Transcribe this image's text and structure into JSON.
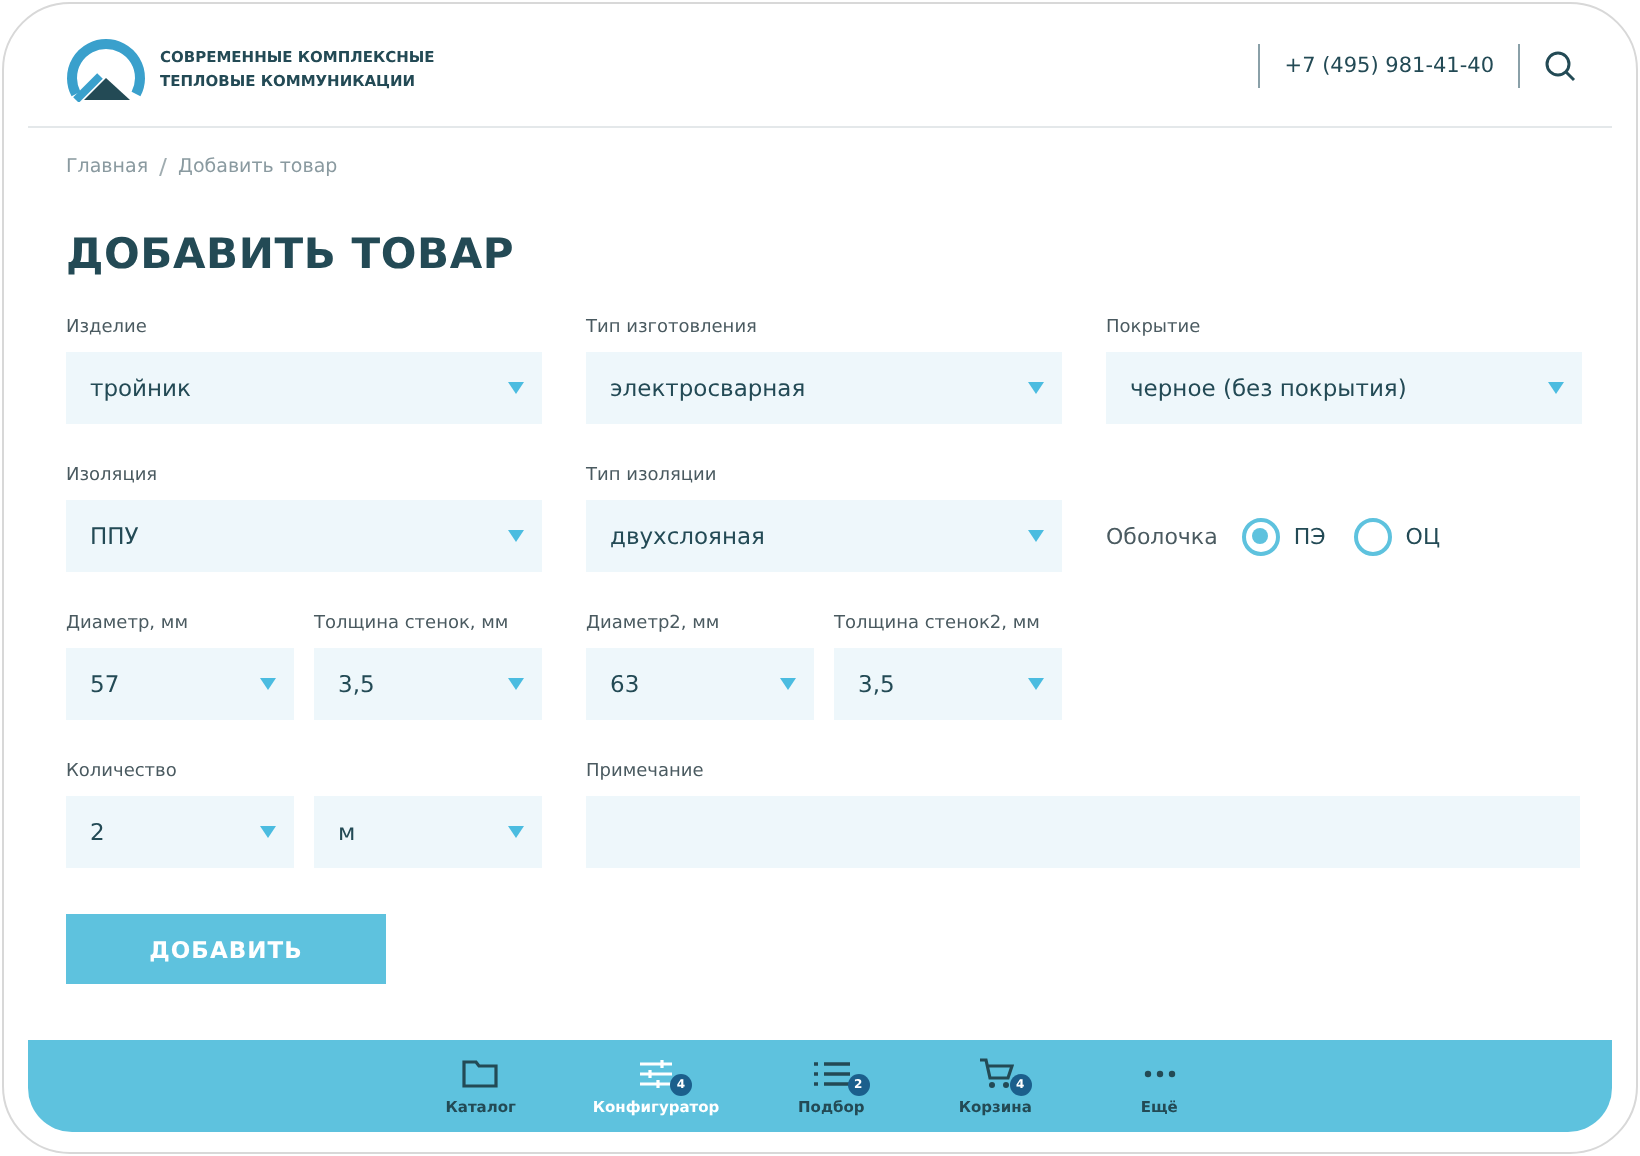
{
  "header": {
    "logo_text": [
      "СОВРЕМЕННЫЕ КОМПЛЕКСНЫЕ",
      "ТЕПЛОВЫЕ КОММУНИКАЦИИ"
    ],
    "phone": "+7 (495) 981-41-40"
  },
  "breadcrumbs": [
    "Главная",
    "Добавить товар"
  ],
  "title": "ДОБАВИТЬ ТОВАР",
  "form_rows": [
    [
      {
        "kind": "select",
        "label": "Изделие",
        "value": "тройник"
      },
      {
        "kind": "select",
        "label": "Тип изготовления",
        "value": "электросварная"
      },
      {
        "kind": "select",
        "label": "Покрытие",
        "value": "черное (без покрытия)"
      }
    ],
    [
      {
        "kind": "select",
        "label": "Изоляция",
        "value": "ППУ"
      },
      {
        "kind": "select",
        "label": "Тип изоляции",
        "value": "двухслояная"
      },
      {
        "kind": "radio",
        "label": "Оболочка",
        "options": [
          {
            "label": "ПЭ",
            "selected": true
          },
          {
            "label": "ОЦ",
            "selected": false
          }
        ]
      }
    ],
    [
      {
        "kind": "pair",
        "fields": [
          {
            "label": "Диаметр, мм",
            "value": "57"
          },
          {
            "label": "Толщина стенок, мм",
            "value": "3,5"
          }
        ]
      },
      {
        "kind": "pair",
        "fields": [
          {
            "label": "Диаметр2, мм",
            "value": "63"
          },
          {
            "label": "Толщина стенок2, мм",
            "value": "3,5"
          }
        ]
      }
    ],
    [
      {
        "kind": "pair",
        "fields": [
          {
            "label": "Количество",
            "value": "2"
          },
          {
            "value": "м"
          }
        ]
      },
      {
        "kind": "text",
        "label": "Примечание"
      }
    ]
  ],
  "submit": "ДОБАВИТЬ",
  "nav": [
    {
      "kind": "folder",
      "label": "Каталог",
      "selected": false
    },
    {
      "kind": "sliders",
      "label": "Конфигуратор",
      "badge": "4",
      "selected": true
    },
    {
      "kind": "list",
      "label": "Подбор",
      "badge": "2",
      "selected": false
    },
    {
      "kind": "cart",
      "label": "Корзина",
      "badge": "4",
      "selected": false
    },
    {
      "kind": "dots",
      "label": "Ещё",
      "selected": false
    }
  ]
}
